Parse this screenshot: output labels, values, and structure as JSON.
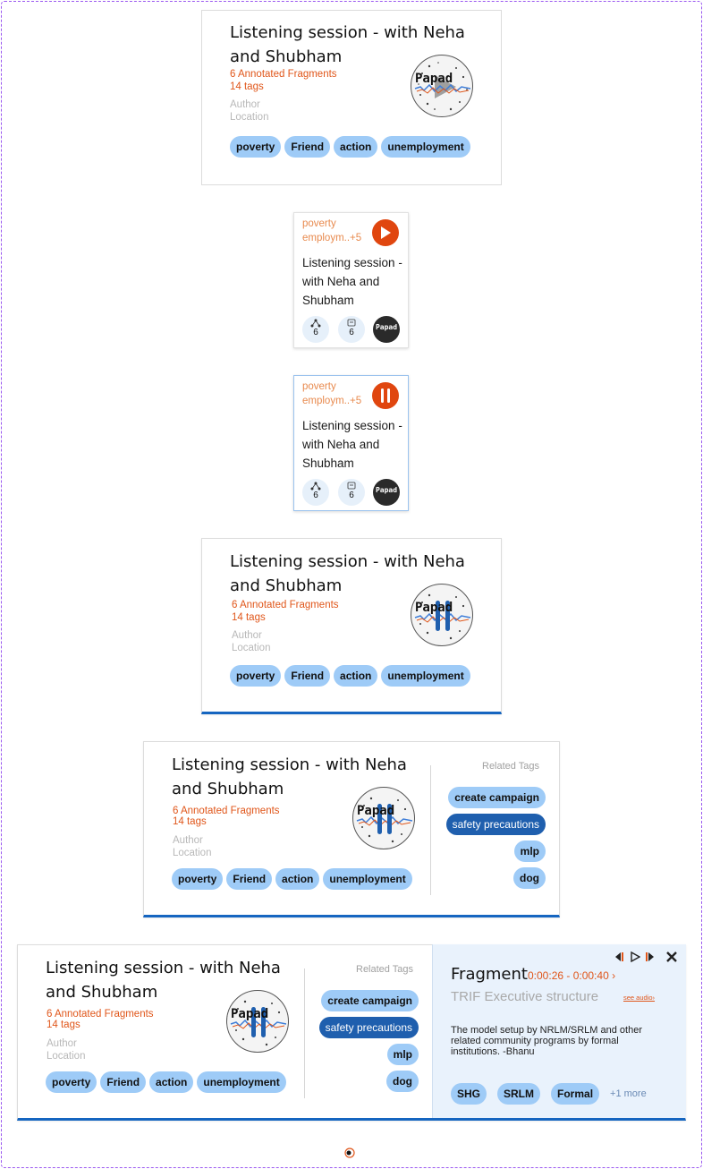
{
  "session": {
    "title": "Listening session - with Neha and Shubham",
    "fragments": "6 Annotated Fragments",
    "tags_count": "14 tags",
    "author": "Author",
    "location": "Location",
    "tags": [
      "poverty",
      "Friend",
      "action",
      "unemployment"
    ]
  },
  "logo": {
    "text": "Papad"
  },
  "small_card": {
    "tags_line1": "poverty",
    "tags_line2": "employm..+5",
    "title": "Listening session - with Neha and Shubham",
    "fragment_count": "6",
    "tag_count": "6"
  },
  "related": {
    "title": "Related Tags",
    "tags": [
      "create campaign",
      "safety precautions",
      "mlp",
      "dog"
    ]
  },
  "fragment": {
    "heading": "Fragment",
    "time": "0:00:26 - 0:00:40 ›",
    "subtitle": "TRIF Executive structure",
    "see_audio": "see audio›",
    "quote": "The model setup by NRLM/SRLM and other related community programs by formal institutions. -Bhanu",
    "tags": [
      "SHG",
      "SRLM",
      "Formal"
    ],
    "more": "+1  more"
  },
  "colors": {
    "accent_orange": "#e0561a",
    "tag_blue": "#9ecbf7",
    "tag_selected": "#1f5fae",
    "selected_border": "#1565c0",
    "fragment_bg": "#e9f2fc",
    "frame_border": "#9b59f0"
  }
}
